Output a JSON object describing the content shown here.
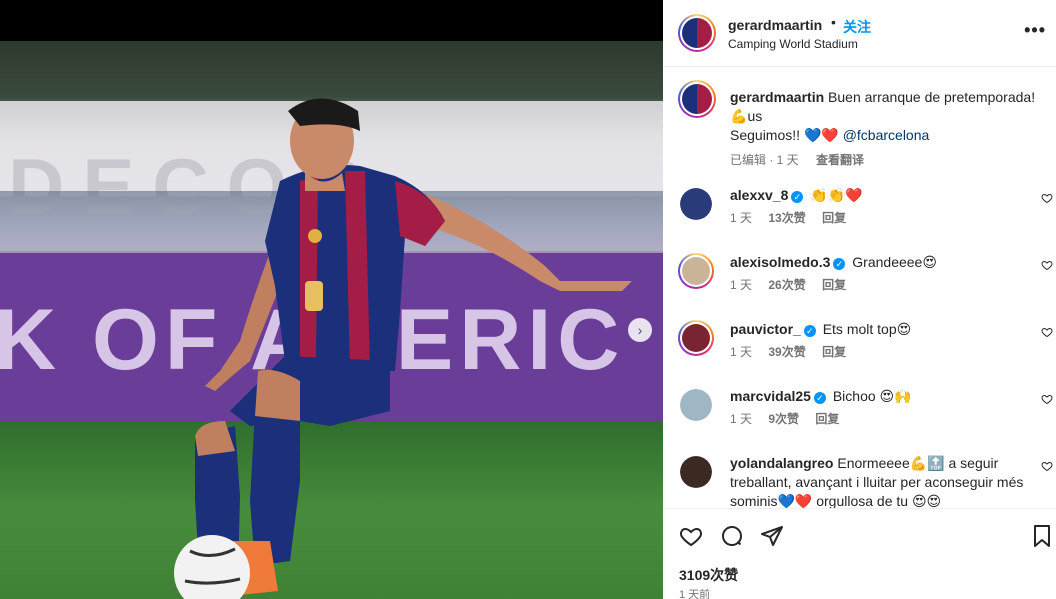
{
  "post": {
    "username": "gerardmaartin",
    "follow_label": "关注",
    "separator": "•",
    "location": "Camping World Stadium",
    "more_label": "•••",
    "caption_text_1": "Buen arranque de pretemporada! ",
    "caption_emoji_1": "💪",
    "caption_text_2": "us",
    "caption_line_2": "Seguimos!! ",
    "caption_hearts": "💙❤️",
    "caption_mention": "@fcbarcelona",
    "edited_label": "已编辑 · 1 天",
    "translate_label": "查看翻译"
  },
  "comments": [
    {
      "user": "alexxv_8",
      "verified": true,
      "text": "👏👏❤️",
      "time": "1 天",
      "likes": "13次赞",
      "reply": "回复",
      "avatar_color": "#2a3b7a"
    },
    {
      "user": "alexisolmedo.3",
      "verified": true,
      "text": "Grandeeee😍",
      "time": "1 天",
      "likes": "26次赞",
      "reply": "回复",
      "avatar_color": "#c9b49a"
    },
    {
      "user": "pauvictor_",
      "verified": true,
      "text": "Ets molt top😍",
      "time": "1 天",
      "likes": "39次赞",
      "reply": "回复",
      "avatar_color": "#7a2433"
    },
    {
      "user": "marcvidal25",
      "verified": true,
      "text": "Bichoo 😍🙌",
      "time": "1 天",
      "likes": "9次赞",
      "reply": "回复",
      "avatar_color": "#9fb6c4"
    },
    {
      "user": "yolandalangreo",
      "verified": false,
      "text": "Enormeeee💪🔝 a seguir treballant, avançant i lluitar per aconseguir més sominis💙❤️ orgullosa de tu 😍😍",
      "time": "",
      "likes": "",
      "reply": "",
      "avatar_color": "#3b2a22"
    }
  ],
  "footer": {
    "likes_count": "3109次赞",
    "timestamp": "1 天前"
  },
  "media": {
    "banner_top_text": "DECOR",
    "banner_mid_text": "K OF AMERIC",
    "next_label": "›"
  },
  "icons": {
    "heart": "heart-icon",
    "comment": "comment-icon",
    "share": "share-icon",
    "bookmark": "bookmark-icon",
    "more": "more-icon",
    "verified": "verified-icon"
  },
  "colors": {
    "follow": "#0095f6",
    "verified": "#0095f6",
    "barca_blue": "#1b2f7a",
    "barca_red": "#a31d47"
  }
}
